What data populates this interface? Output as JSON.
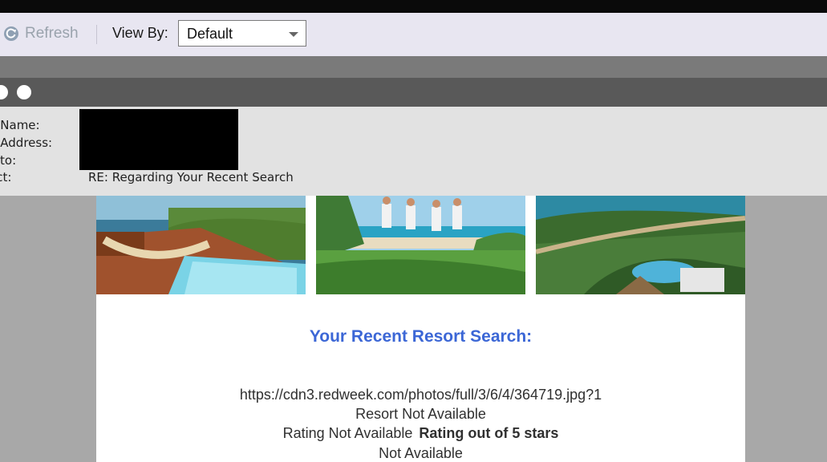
{
  "toolbar": {
    "refresh_label": "Refresh",
    "view_by_label": "View By:",
    "view_by_value": "Default"
  },
  "email_header": {
    "from_name_label": "n Name:",
    "from_address_label": "n Address:",
    "reply_to_label": "y-to:",
    "subject_label": "ect:",
    "subject_value": "RE: Regarding Your Recent Search"
  },
  "email_body": {
    "heading": "Your Recent Resort Search:",
    "image_url_text": "https://cdn3.redweek.com/photos/full/3/6/4/364719.jpg?1",
    "resort_text": "Resort Not Available",
    "rating_text": "Rating Not Available",
    "rating_bold": "Rating out of 5 stars",
    "availability_text": "Not Available"
  },
  "colors": {
    "heading_blue": "#3c67d6",
    "toolbar_bg": "#e8e6f1",
    "header_bg": "#e2e2e2"
  }
}
